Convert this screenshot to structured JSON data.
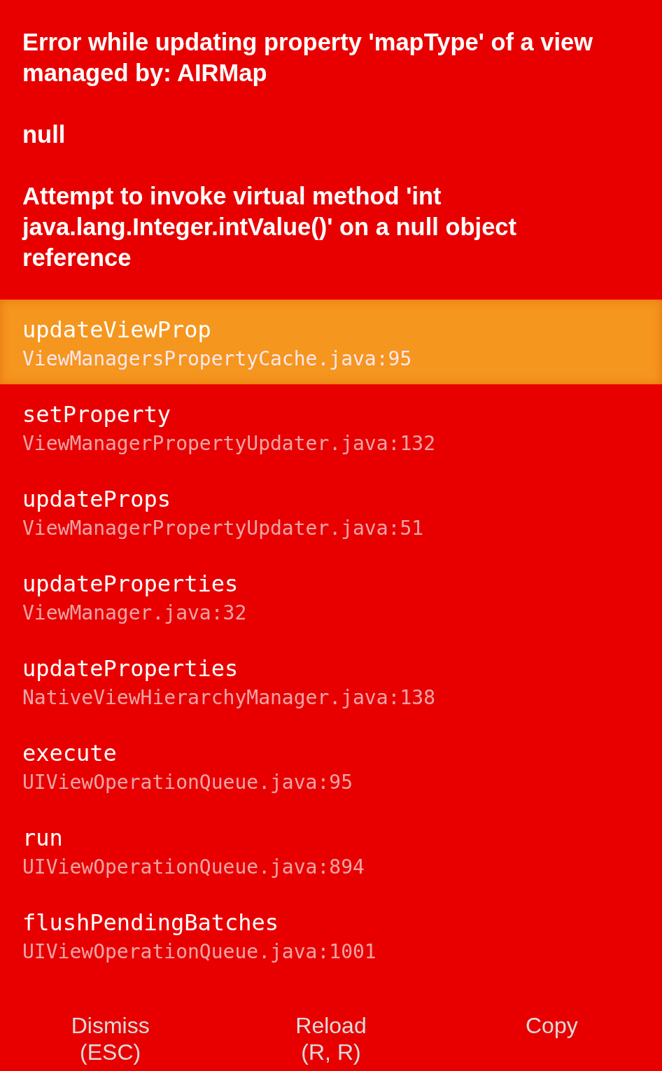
{
  "message": [
    "Error while updating property 'mapType' of a view managed by: AIRMap",
    "null",
    "Attempt to invoke virtual method 'int java.lang.Integer.intValue()' on a null object reference"
  ],
  "frames": [
    {
      "method": "updateViewProp",
      "file": "ViewManagersPropertyCache.java:95",
      "selected": true
    },
    {
      "method": "setProperty",
      "file": "ViewManagerPropertyUpdater.java:132",
      "selected": false
    },
    {
      "method": "updateProps",
      "file": "ViewManagerPropertyUpdater.java:51",
      "selected": false
    },
    {
      "method": "updateProperties",
      "file": "ViewManager.java:32",
      "selected": false
    },
    {
      "method": "updateProperties",
      "file": "NativeViewHierarchyManager.java:138",
      "selected": false
    },
    {
      "method": "execute",
      "file": "UIViewOperationQueue.java:95",
      "selected": false
    },
    {
      "method": "run",
      "file": "UIViewOperationQueue.java:894",
      "selected": false
    },
    {
      "method": "flushPendingBatches",
      "file": "UIViewOperationQueue.java:1001",
      "selected": false
    }
  ],
  "buttons": [
    {
      "label": "Dismiss\n(ESC)"
    },
    {
      "label": "Reload\n(R, R)"
    },
    {
      "label": "Copy"
    }
  ]
}
